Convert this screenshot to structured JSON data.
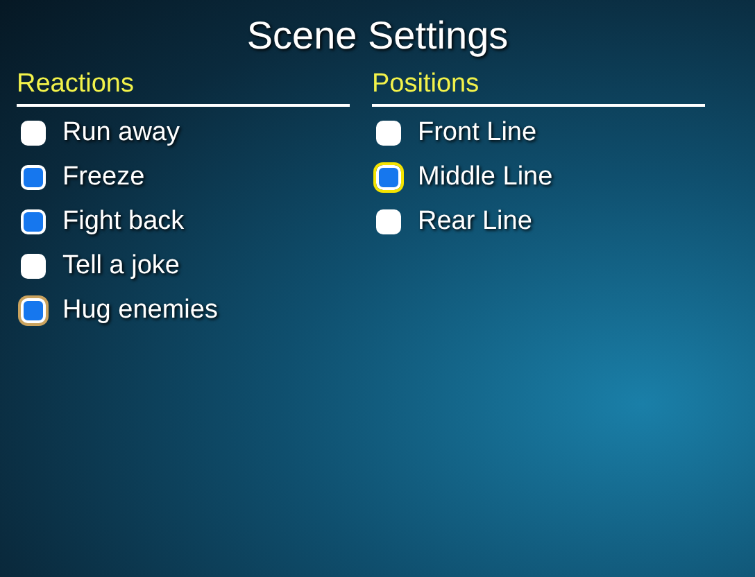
{
  "title": "Scene Settings",
  "groups": [
    {
      "heading": "Reactions",
      "items": [
        {
          "label": "Run away",
          "checked": false,
          "hovered": false,
          "focused": false
        },
        {
          "label": "Freeze",
          "checked": true,
          "hovered": false,
          "focused": false
        },
        {
          "label": "Fight back",
          "checked": true,
          "hovered": false,
          "focused": false
        },
        {
          "label": "Tell a joke",
          "checked": false,
          "hovered": false,
          "focused": false
        },
        {
          "label": "Hug enemies",
          "checked": true,
          "hovered": true,
          "focused": false
        }
      ]
    },
    {
      "heading": "Positions",
      "items": [
        {
          "label": "Front Line",
          "checked": false,
          "hovered": false,
          "focused": false
        },
        {
          "label": "Middle Line",
          "checked": true,
          "hovered": false,
          "focused": true
        },
        {
          "label": "Rear Line",
          "checked": false,
          "hovered": false,
          "focused": false
        }
      ]
    }
  ]
}
